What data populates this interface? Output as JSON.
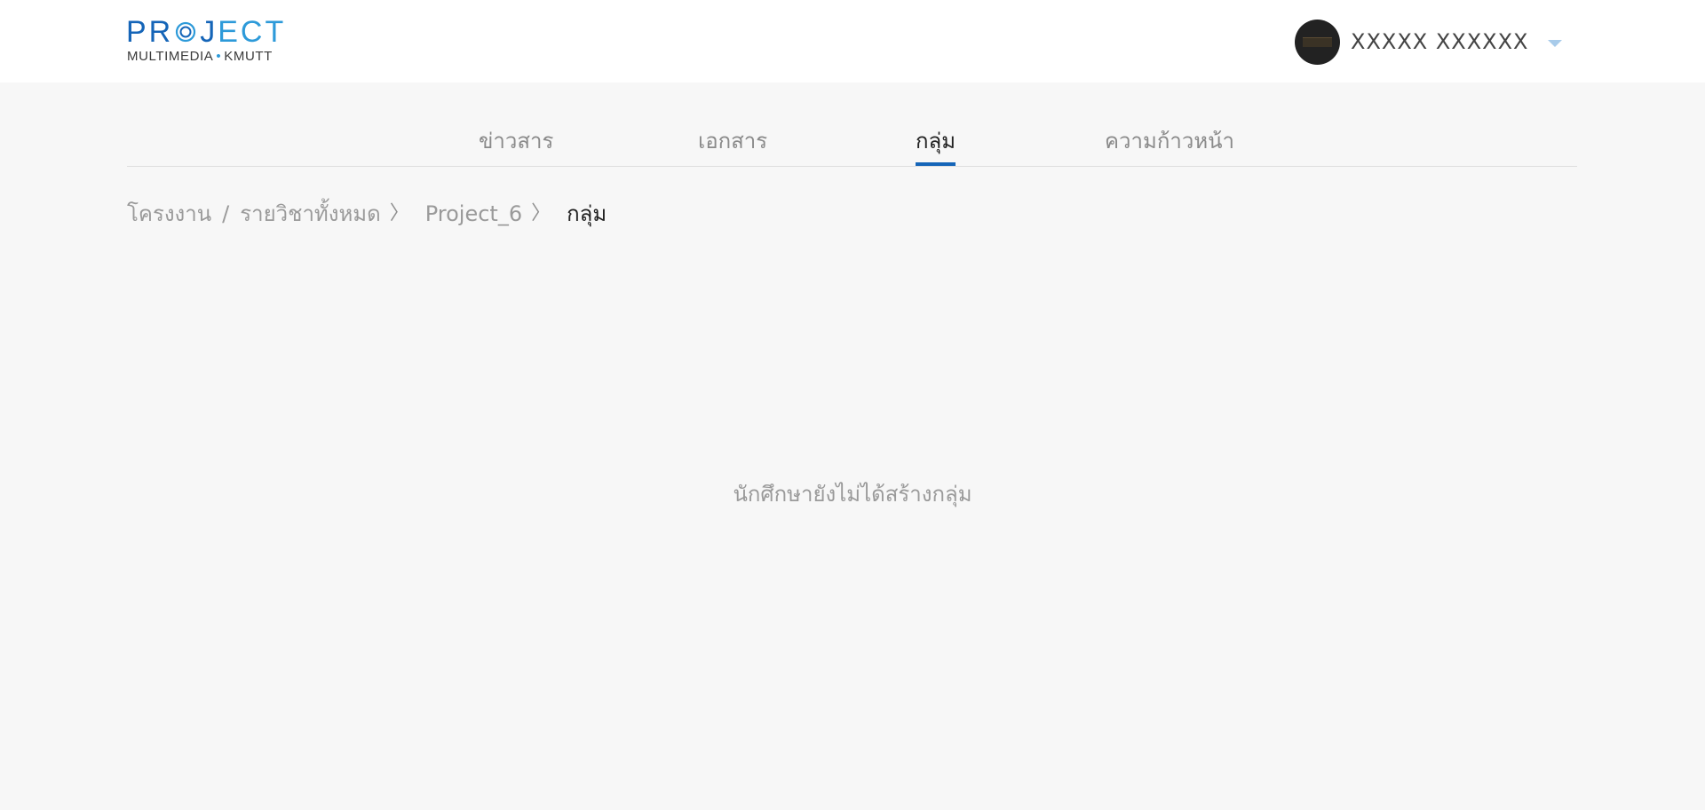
{
  "header": {
    "logo": {
      "title_part1": "PR",
      "title_part2": "J",
      "title_part3": "ECT",
      "subtitle_left": "MULTIMEDIA",
      "subtitle_dot": "•",
      "subtitle_right": "KMUTT"
    },
    "user": {
      "name": "XXXXX XXXXXX",
      "avatar_icon": "avatar-photo",
      "menu_icon": "caret-down-icon"
    },
    "colors": {
      "brand_dark": "#1565b8",
      "brand_light": "#2d9ad9",
      "caret": "#a8cbea"
    }
  },
  "tabs": [
    {
      "label": "ข่าวสาร",
      "active": false
    },
    {
      "label": "เอกสาร",
      "active": false
    },
    {
      "label": "กลุ่ม",
      "active": true
    },
    {
      "label": "ความก้าวหน้า",
      "active": false
    }
  ],
  "breadcrumb": {
    "items": [
      "โครงงาน",
      "รายวิชาทั้งหมด",
      "Project_6",
      "กลุ่ม"
    ],
    "separator_slash": "/",
    "separator_chevron": "〉"
  },
  "main": {
    "empty_message": "นักศึกษายังไม่ได้สร้างกลุ่ม"
  }
}
